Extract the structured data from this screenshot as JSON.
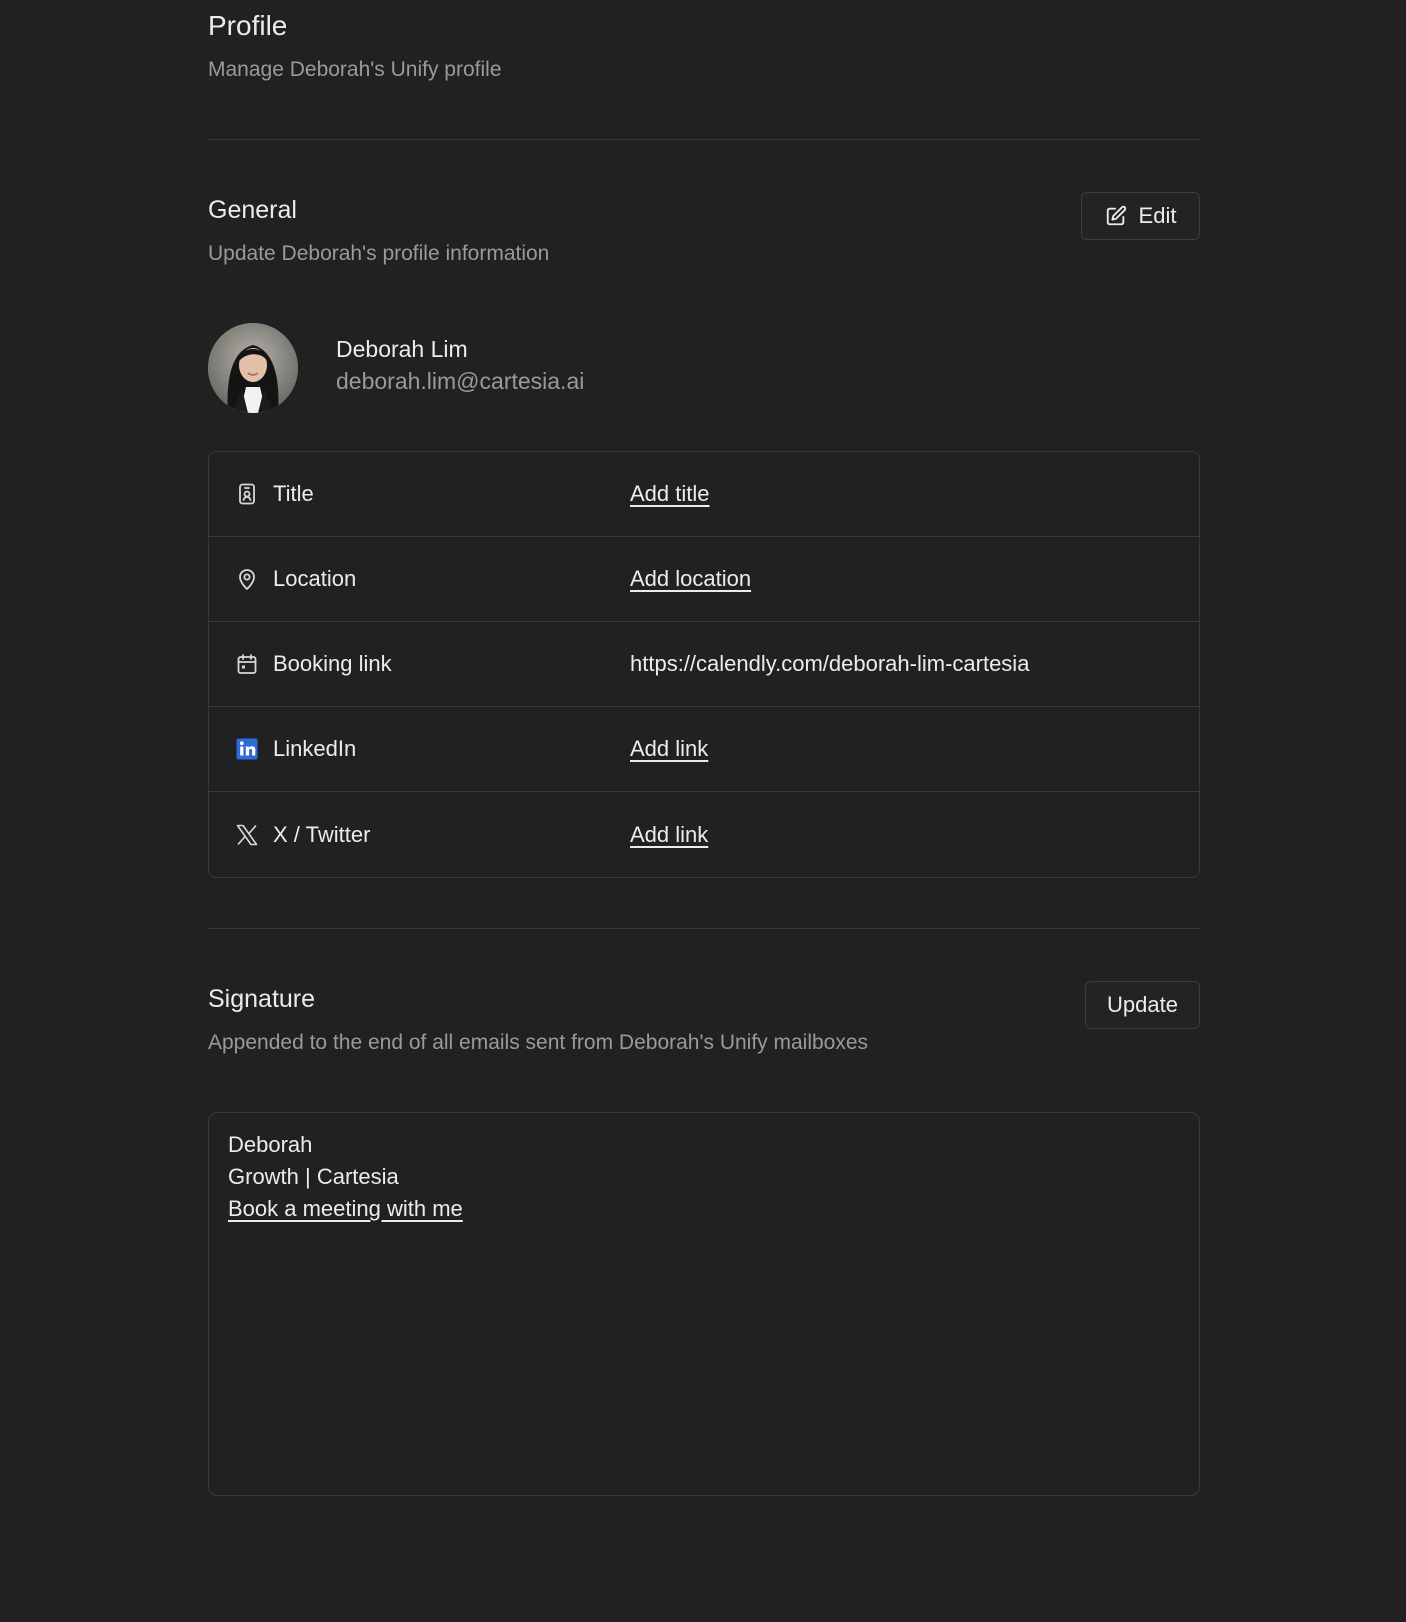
{
  "header": {
    "title": "Profile",
    "subtitle": "Manage Deborah's Unify profile"
  },
  "general": {
    "title": "General",
    "subtitle": "Update Deborah's profile information",
    "edit_label": "Edit",
    "edit_icon": "pencil-square-icon"
  },
  "user": {
    "name": "Deborah Lim",
    "email": "deborah.lim@cartesia.ai",
    "avatar": "profile-photo"
  },
  "fields": [
    {
      "label": "Title",
      "value": "Add title",
      "icon": "id-badge-icon",
      "is_placeholder_link": true
    },
    {
      "label": "Location",
      "value": "Add location",
      "icon": "map-pin-icon",
      "is_placeholder_link": true
    },
    {
      "label": "Booking link",
      "value": "https://calendly.com/deborah-lim-cartesia",
      "icon": "calendar-icon",
      "is_placeholder_link": false
    },
    {
      "label": "LinkedIn",
      "value": "Add link",
      "icon": "linkedin-icon",
      "is_placeholder_link": true
    },
    {
      "label": "X / Twitter",
      "value": "Add link",
      "icon": "x-twitter-icon",
      "is_placeholder_link": true
    }
  ],
  "signature": {
    "title": "Signature",
    "subtitle": "Appended to the end of all emails sent from Deborah's Unify mailboxes",
    "update_label": "Update",
    "lines": [
      "Deborah",
      "Growth | Cartesia"
    ],
    "link_text": "Book a meeting with me"
  },
  "colors": {
    "background": "#212121",
    "border": "#3a3a3a",
    "text": "#ececec",
    "muted": "#9a9a9a",
    "linkedin": "#2f6bd6"
  }
}
